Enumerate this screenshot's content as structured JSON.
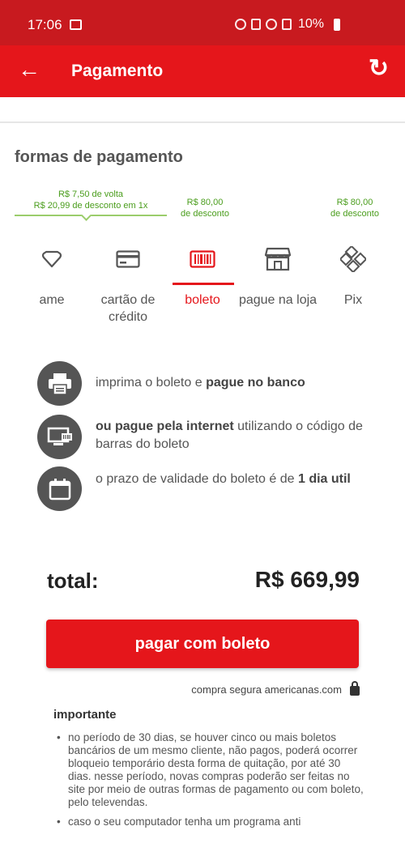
{
  "status_bar": {
    "time": "17:06",
    "battery": "10%"
  },
  "app_bar": {
    "title": "Pagamento"
  },
  "section": {
    "title": "formas de pagamento"
  },
  "discounts": {
    "ame": {
      "line1": "R$ 7,50  de volta",
      "line2": "R$ 20,99 de desconto em 1x"
    },
    "boleto": {
      "line1": "R$ 80,00",
      "line2": "de desconto"
    },
    "pix": {
      "line1": "R$ 80,00",
      "line2": "de desconto"
    }
  },
  "payment_tabs": [
    {
      "label": "ame",
      "icon": "heart-icon"
    },
    {
      "label": "cartão de crédito",
      "icon": "credit-card-icon"
    },
    {
      "label": "boleto",
      "icon": "barcode-icon",
      "active": true
    },
    {
      "label": "pague na loja",
      "icon": "store-icon"
    },
    {
      "label": "Pix",
      "icon": "pix-icon"
    }
  ],
  "info": [
    {
      "pre": "imprima o boleto e ",
      "bold": "pague no banco",
      "post": ""
    },
    {
      "pre": "",
      "bold": "ou pague pela internet",
      "post": " utilizando o código de barras do boleto"
    },
    {
      "pre": "o prazo de validade do boleto é de ",
      "bold": "1 dia util",
      "post": ""
    }
  ],
  "total": {
    "label": "total:",
    "value": "R$ 669,99"
  },
  "pay_button": {
    "label": "pagar com boleto"
  },
  "secure": {
    "text": "compra segura americanas.com"
  },
  "important": {
    "title": "importante",
    "items": [
      "no período de 30 dias, se houver cinco ou mais boletos bancários de um mesmo cliente, não pagos, poderá ocorrer bloqueio temporário desta forma de quitação, por até 30 dias. nesse período, novas compras poderão ser feitas no site por meio de outras formas de pagamento ou com boleto, pelo televendas.",
      "caso o seu computador tenha um programa anti"
    ]
  },
  "colors": {
    "brand_red": "#e5161b",
    "status_red": "#c81a1f",
    "discount_green": "#4a9d1c"
  }
}
